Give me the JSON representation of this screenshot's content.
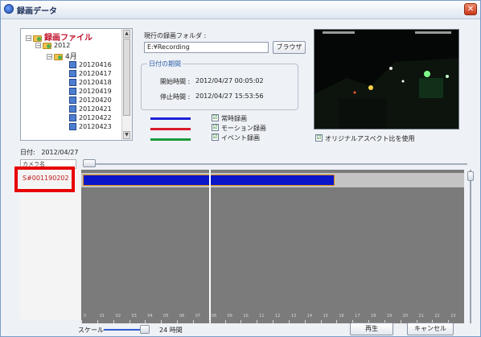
{
  "window": {
    "title": "録画データ",
    "close_icon": "close-icon"
  },
  "tree": {
    "root": "録画ファイル",
    "year": "2012",
    "month": "4月",
    "dates": [
      "20120416",
      "20120417",
      "20120418",
      "20120419",
      "20120420",
      "20120421",
      "20120422",
      "20120423"
    ]
  },
  "folder": {
    "label": "現行の録画フォルダ :",
    "value": "E:¥Recording",
    "browse_label": "ブラウザ"
  },
  "period": {
    "legend": "日付の期間",
    "start_label": "開始時間 :",
    "start_value": "2012/04/27 00:05:02",
    "end_label": "停止時間 :",
    "end_value": "2012/04/27 15:53:56"
  },
  "legend": [
    {
      "label": "常時録画",
      "color": "#1a22d8",
      "checked": "☑"
    },
    {
      "label": "モーション録画",
      "color": "#d81a2a",
      "checked": "☑"
    },
    {
      "label": "イベント録画",
      "color": "#1a9a3a",
      "checked": "☑"
    }
  ],
  "aspect": {
    "label": "オリジナルアスペクト比を使用",
    "checked": "☑"
  },
  "date": {
    "label": "日付:",
    "value": "2012/04/27"
  },
  "camera": {
    "header": "カメラ名",
    "item": "S#001190202"
  },
  "timeline": {
    "hours": [
      "0",
      "01",
      "02",
      "03",
      "04",
      "05",
      "06",
      "07",
      "08",
      "09",
      "10",
      "11",
      "12",
      "13",
      "14",
      "15",
      "16",
      "17",
      "18",
      "19",
      "20",
      "21",
      "22",
      "23"
    ],
    "recording_start_hour": 0.08,
    "recording_end_hour": 15.9,
    "cursor_hour": 8.0
  },
  "scale": {
    "label": "スケール",
    "value": "24 時間"
  },
  "buttons": {
    "play": "再生",
    "cancel": "キャンセル"
  }
}
